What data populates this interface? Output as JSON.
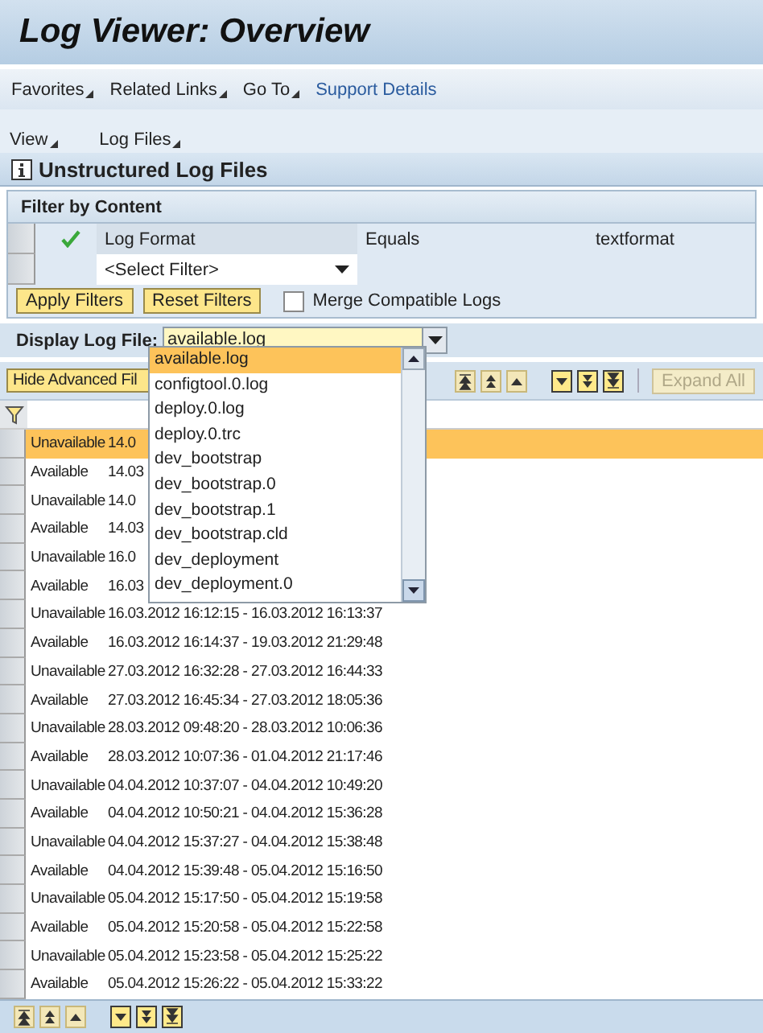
{
  "window": {
    "title": "Log Viewer: Overview"
  },
  "menu_bar": [
    {
      "label": "Favorites",
      "kind": "menu"
    },
    {
      "label": "Related Links",
      "kind": "menu"
    },
    {
      "label": "Go To",
      "kind": "menu"
    },
    {
      "label": "Support Details",
      "kind": "link"
    }
  ],
  "sub_menu": [
    {
      "label": "View"
    },
    {
      "label": "Log Files"
    }
  ],
  "panel": {
    "title": "Unstructured Log Files"
  },
  "filter": {
    "title": "Filter by Content",
    "rows": [
      {
        "active": true,
        "field": "Log Format",
        "operator": "Equals",
        "value": "textformat",
        "kind": "condition"
      },
      {
        "active": false,
        "field": "<Select Filter>",
        "kind": "select"
      }
    ],
    "buttons": [
      "Apply Filters",
      "Reset Filters"
    ],
    "merge": {
      "label": "Merge Compatible Logs",
      "checked": false
    }
  },
  "display": {
    "label": "Display Log File:",
    "value": "available.log",
    "options": [
      {
        "label": "available.log",
        "selected": true
      },
      {
        "label": "configtool.0.log",
        "selected": false
      },
      {
        "label": "deploy.0.log",
        "selected": false
      },
      {
        "label": "deploy.0.trc",
        "selected": false
      },
      {
        "label": "dev_bootstrap",
        "selected": false
      },
      {
        "label": "dev_bootstrap.0",
        "selected": false
      },
      {
        "label": "dev_bootstrap.1",
        "selected": false
      },
      {
        "label": "dev_bootstrap.cld",
        "selected": false
      },
      {
        "label": "dev_deployment",
        "selected": false
      },
      {
        "label": "dev_deployment.0",
        "selected": false
      }
    ]
  },
  "toolbar": {
    "hide_button": "Hide Advanced Fil",
    "expand_button": {
      "label": "Expand All",
      "disabled": true
    }
  },
  "table": {
    "rows": [
      {
        "status": "Unavailable",
        "range": "14.0",
        "selected": true
      },
      {
        "status": "Available",
        "range": "14.03",
        "selected": false
      },
      {
        "status": "Unavailable",
        "range": "14.0",
        "selected": false
      },
      {
        "status": "Available",
        "range": "14.03",
        "selected": false
      },
      {
        "status": "Unavailable",
        "range": "16.0",
        "selected": false
      },
      {
        "status": "Available",
        "range": "16.03",
        "selected": false
      },
      {
        "status": "Unavailable",
        "range": "16.03.2012 16:12:15 - 16.03.2012 16:13:37",
        "selected": false
      },
      {
        "status": "Available",
        "range": "16.03.2012 16:14:37 - 19.03.2012 21:29:48",
        "selected": false
      },
      {
        "status": "Unavailable",
        "range": "27.03.2012 16:32:28 - 27.03.2012 16:44:33",
        "selected": false
      },
      {
        "status": "Available",
        "range": "27.03.2012 16:45:34 - 27.03.2012 18:05:36",
        "selected": false
      },
      {
        "status": "Unavailable",
        "range": "28.03.2012 09:48:20 - 28.03.2012 10:06:36",
        "selected": false
      },
      {
        "status": "Available",
        "range": "28.03.2012 10:07:36 - 01.04.2012 21:17:46",
        "selected": false
      },
      {
        "status": "Unavailable",
        "range": "04.04.2012 10:37:07 - 04.04.2012 10:49:20",
        "selected": false
      },
      {
        "status": "Available",
        "range": "04.04.2012 10:50:21 - 04.04.2012 15:36:28",
        "selected": false
      },
      {
        "status": "Unavailable",
        "range": "04.04.2012 15:37:27 - 04.04.2012 15:38:48",
        "selected": false
      },
      {
        "status": "Available",
        "range": "04.04.2012 15:39:48 - 05.04.2012 15:16:50",
        "selected": false
      },
      {
        "status": "Unavailable",
        "range": "05.04.2012 15:17:50 - 05.04.2012 15:19:58",
        "selected": false
      },
      {
        "status": "Available",
        "range": "05.04.2012 15:20:58 - 05.04.2012 15:22:58",
        "selected": false
      },
      {
        "status": "Unavailable",
        "range": "05.04.2012 15:23:58 - 05.04.2012 15:25:22",
        "selected": false
      },
      {
        "status": "Available",
        "range": "05.04.2012 15:26:22 - 05.04.2012 15:33:22",
        "selected": false
      }
    ]
  }
}
